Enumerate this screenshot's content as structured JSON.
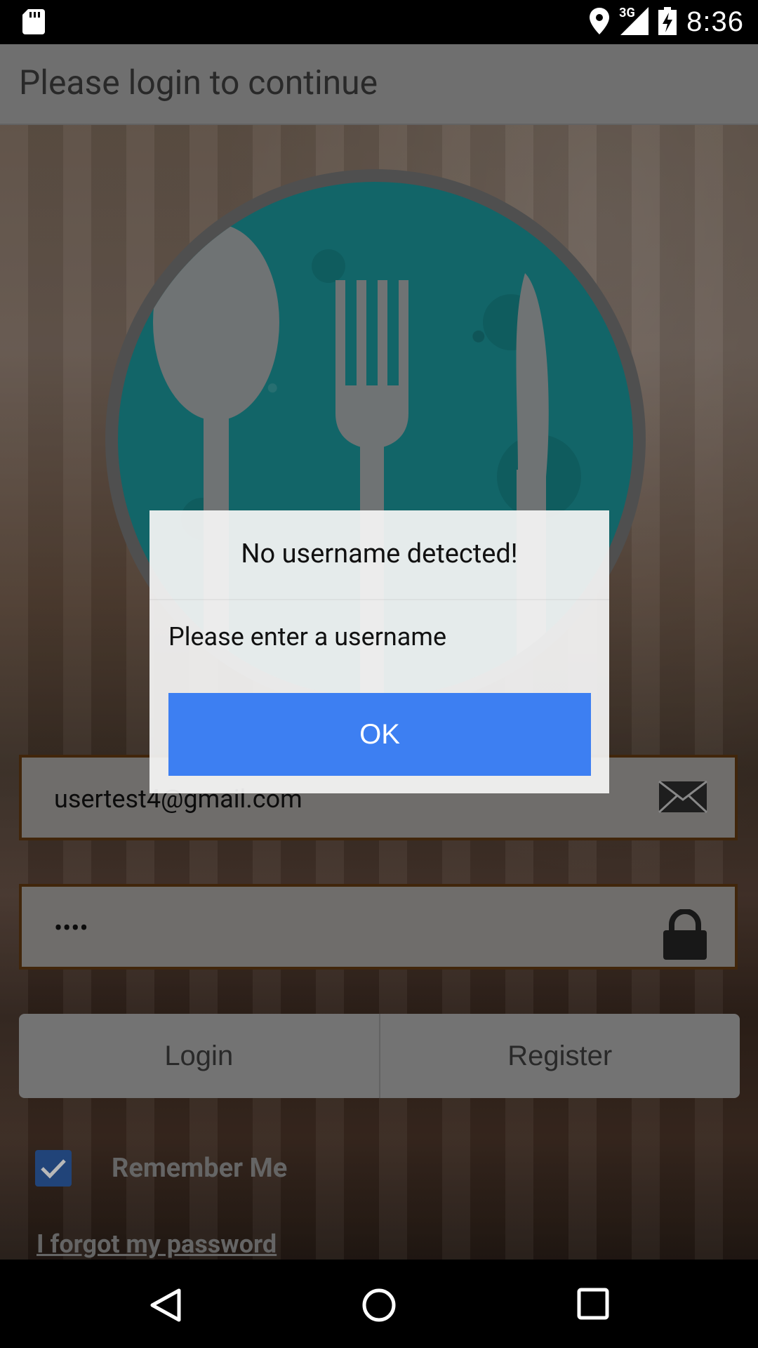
{
  "status_bar": {
    "time": "8:36",
    "network_label": "3G",
    "icons": [
      "sd-card-icon",
      "location-icon",
      "signal-icon",
      "battery-charging-icon"
    ]
  },
  "app_bar": {
    "title": "Please login to continue"
  },
  "form": {
    "email_value": "usertest4@gmail.com",
    "password_value": "••••",
    "email_icon": "envelope-icon",
    "password_icon": "lock-icon",
    "login_label": "Login",
    "register_label": "Register",
    "remember_label": "Remember Me",
    "remember_checked": true,
    "forgot_label": "I forgot my password"
  },
  "dialog": {
    "title": "No username detected!",
    "message": "Please enter a username",
    "ok_label": "OK"
  },
  "nav_bar": {
    "icons": [
      "back-icon",
      "home-icon",
      "recents-icon"
    ]
  },
  "colors": {
    "dialog_button": "#3d7ff2",
    "checkbox": "#2f5fa8",
    "logo_teal": "#1a8c90"
  }
}
